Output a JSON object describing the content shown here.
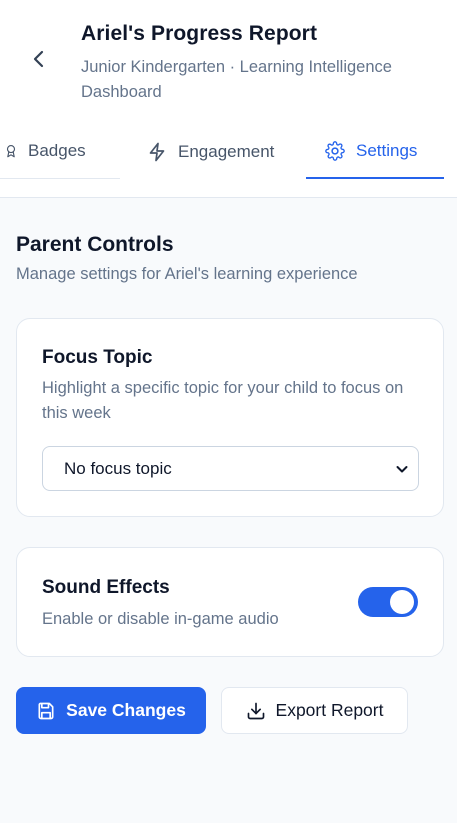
{
  "header": {
    "title": "Ariel's Progress Report",
    "subtitle": "Junior Kindergarten · Learning Intelligence Dashboard",
    "back_icon": "chevron-left-icon"
  },
  "tabs": [
    {
      "label": "Badges",
      "icon": "badge-icon",
      "active": false
    },
    {
      "label": "Engagement",
      "icon": "lightning-icon",
      "active": false
    },
    {
      "label": "Settings",
      "icon": "gear-icon",
      "active": true
    }
  ],
  "parent_controls": {
    "title": "Parent Controls",
    "subtitle": "Manage settings for Ariel's learning experience"
  },
  "focus_topic": {
    "title": "Focus Topic",
    "description": "Highlight a specific topic for your child to focus on this week",
    "select_value": "No focus topic"
  },
  "sound_effects": {
    "title": "Sound Effects",
    "description": "Enable or disable in-game audio",
    "enabled": true
  },
  "actions": {
    "save_label": "Save Changes",
    "export_label": "Export Report"
  },
  "colors": {
    "accent": "#2563eb",
    "text_primary": "#0f172a",
    "text_secondary": "#64748b",
    "background": "#f8fafc"
  }
}
